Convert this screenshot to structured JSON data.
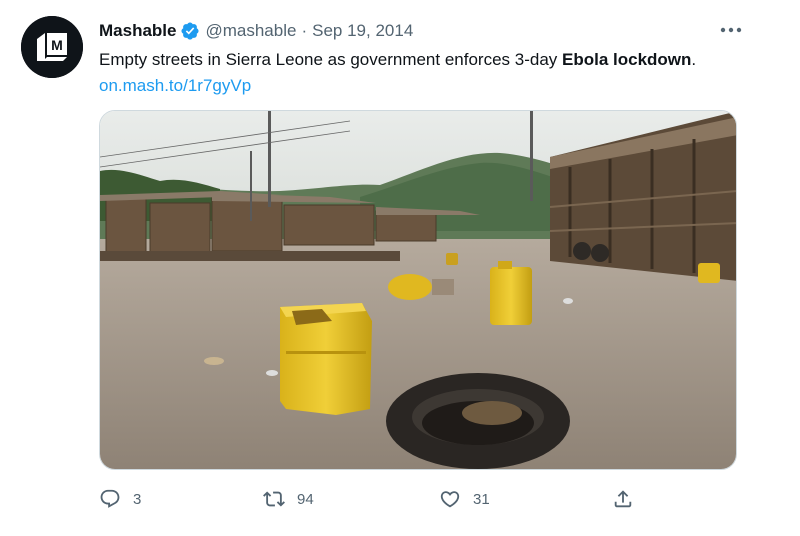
{
  "author": {
    "display_name": "Mashable",
    "handle": "@mashable",
    "separator": "·",
    "date": "Sep 19, 2014",
    "avatar_letter": "M",
    "verified_color": "#1d9bf0"
  },
  "tweet": {
    "text_before": "Empty streets in Sierra Leone as government enforces 3-day ",
    "text_bold": "Ebola lockdown",
    "text_after": ". ",
    "link": "on.mash.to/1r7gyVp"
  },
  "media": {
    "description_icon": "photo"
  },
  "metrics": {
    "replies": "3",
    "retweets": "94",
    "likes": "31"
  },
  "icons": {
    "reply": "reply-icon",
    "retweet": "retweet-icon",
    "like": "heart-icon",
    "share": "share-icon",
    "more": "more-icon",
    "verified": "verified-badge-icon"
  },
  "colors": {
    "accent": "#1d9bf0",
    "secondary_text": "#536471",
    "primary_text": "#0f1419"
  }
}
